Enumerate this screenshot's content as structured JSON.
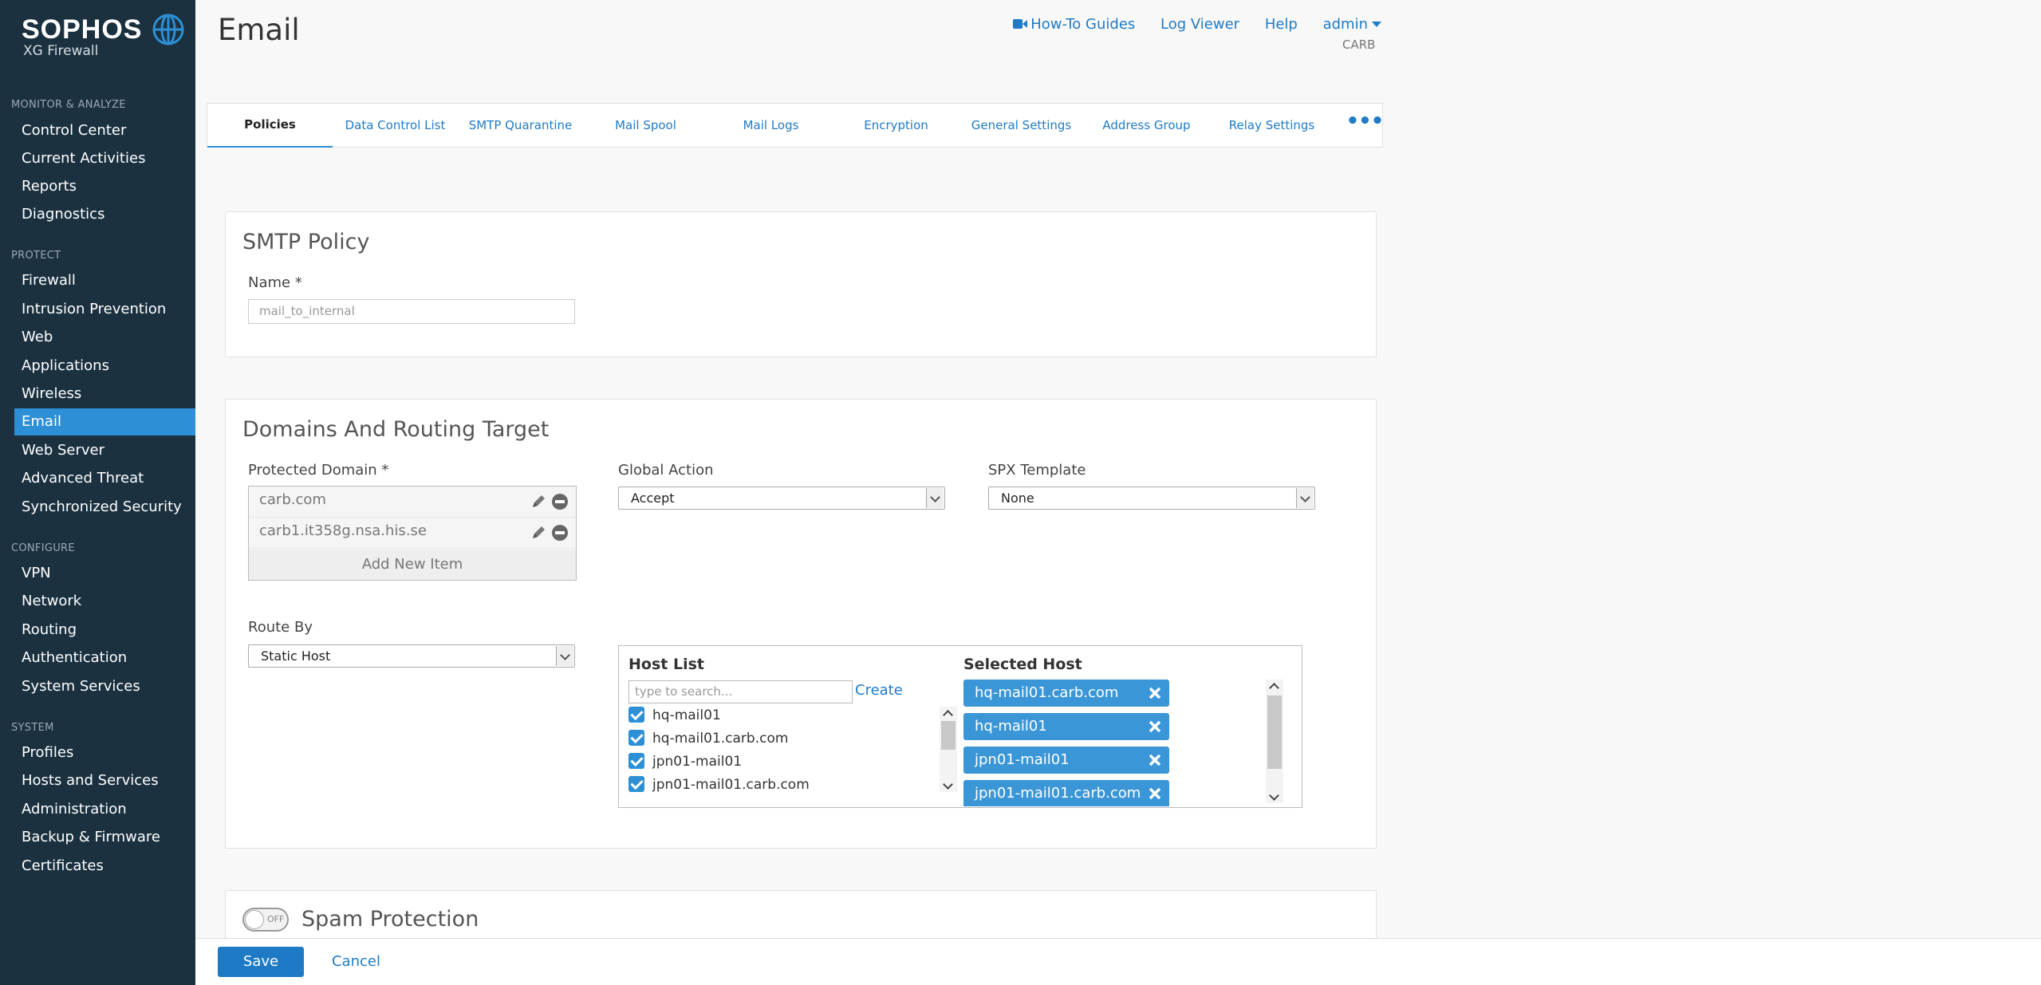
{
  "brand": {
    "name": "SOPHOS",
    "product": "XG Firewall"
  },
  "sidebar": {
    "sections": [
      {
        "label": "MONITOR & ANALYZE",
        "items": [
          "Control Center",
          "Current Activities",
          "Reports",
          "Diagnostics"
        ]
      },
      {
        "label": "PROTECT",
        "items": [
          "Firewall",
          "Intrusion Prevention",
          "Web",
          "Applications",
          "Wireless",
          "Email",
          "Web Server",
          "Advanced Threat",
          "Synchronized Security"
        ]
      },
      {
        "label": "CONFIGURE",
        "items": [
          "VPN",
          "Network",
          "Routing",
          "Authentication",
          "System Services"
        ]
      },
      {
        "label": "SYSTEM",
        "items": [
          "Profiles",
          "Hosts and Services",
          "Administration",
          "Backup & Firmware",
          "Certificates"
        ]
      }
    ],
    "active_item": "Email"
  },
  "header": {
    "title": "Email",
    "links": {
      "how_to": "How-To Guides",
      "log_viewer": "Log Viewer",
      "help": "Help",
      "user": "admin"
    },
    "org": "CARB"
  },
  "tabs": [
    "Policies",
    "Data Control List",
    "SMTP Quarantine",
    "Mail Spool",
    "Mail Logs",
    "Encryption",
    "General Settings",
    "Address Group",
    "Relay Settings"
  ],
  "active_tab": "Policies",
  "smtp_policy": {
    "title": "SMTP Policy",
    "name_label": "Name *",
    "name_value": "mail_to_internal"
  },
  "routing": {
    "title": "Domains And Routing Target",
    "protected_domain_label": "Protected Domain *",
    "domains": [
      "carb.com",
      "carb1.it358g.nsa.his.se"
    ],
    "add_new_item": "Add New Item",
    "global_action_label": "Global Action",
    "global_action_value": "Accept",
    "spx_template_label": "SPX Template",
    "spx_template_value": "None",
    "route_by_label": "Route By",
    "route_by_value": "Static Host",
    "host_list": {
      "title": "Host List",
      "search_placeholder": "type to search...",
      "create": "Create",
      "items": [
        "hq-mail01",
        "hq-mail01.carb.com",
        "jpn01-mail01",
        "jpn01-mail01.carb.com"
      ]
    },
    "selected_host": {
      "title": "Selected Host",
      "items": [
        "hq-mail01.carb.com",
        "hq-mail01",
        "jpn01-mail01",
        "jpn01-mail01.carb.com"
      ]
    }
  },
  "spam": {
    "title": "Spam Protection",
    "toggle": "OFF"
  },
  "footer": {
    "save": "Save",
    "cancel": "Cancel"
  },
  "colors": {
    "sidebar_bg": "#1b3140",
    "accent": "#2d8fd5",
    "link": "#1f7bc6"
  }
}
